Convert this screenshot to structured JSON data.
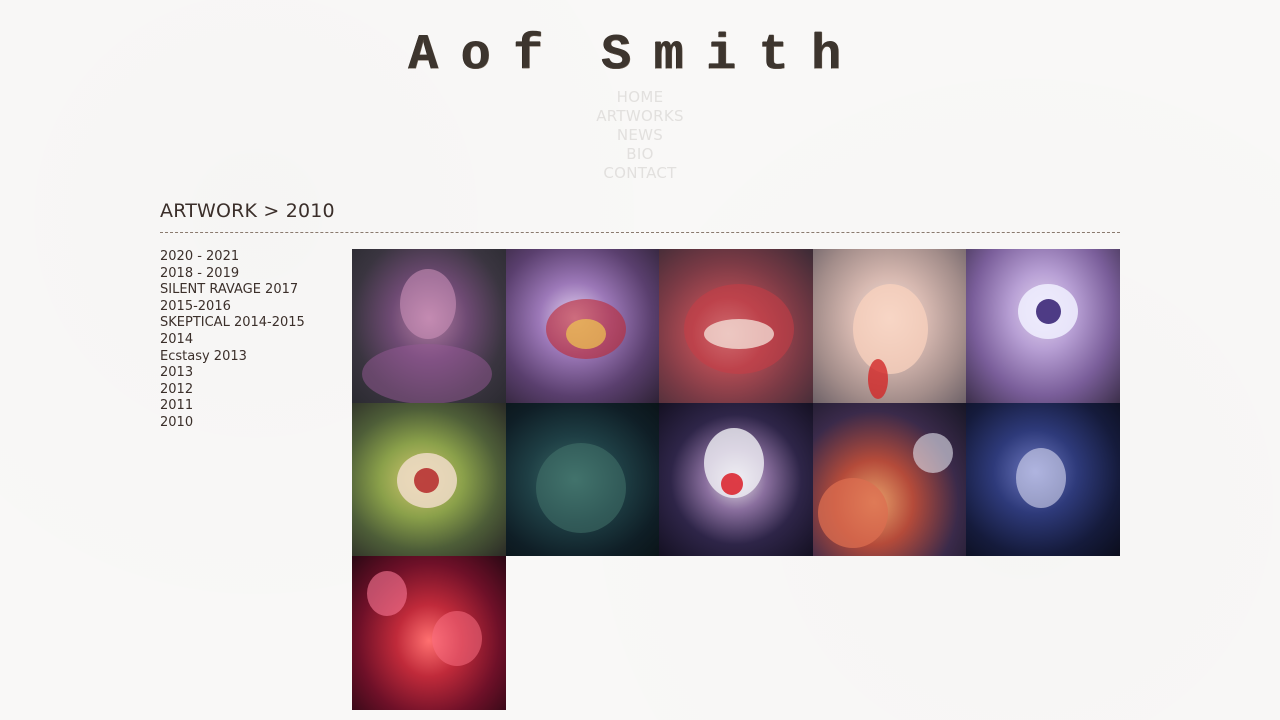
{
  "header": {
    "logo_first": "Aof",
    "logo_last": "Smith"
  },
  "top_nav": [
    {
      "label": "HOME"
    },
    {
      "label": "ARTWORKS"
    },
    {
      "label": "NEWS"
    },
    {
      "label": "BIO"
    },
    {
      "label": "CONTACT"
    }
  ],
  "section": {
    "title": "ARTWORK > 2010"
  },
  "side_nav": [
    {
      "label": "2020 - 2021"
    },
    {
      "label": "2018 - 2019"
    },
    {
      "label": "SILENT RAVAGE 2017"
    },
    {
      "label": "2015-2016"
    },
    {
      "label": "SKEPTICAL 2014-2015"
    },
    {
      "label": "2014"
    },
    {
      "label": "Ecstasy 2013"
    },
    {
      "label": "2013"
    },
    {
      "label": "2012"
    },
    {
      "label": "2011"
    },
    {
      "label": "2010"
    }
  ],
  "gallery": {
    "count": 11
  },
  "colors": {
    "background": "#f9f8f7",
    "text": "#3b2f2a",
    "nav_faded": "#e2e0de",
    "divider": "#8a7a6e"
  }
}
